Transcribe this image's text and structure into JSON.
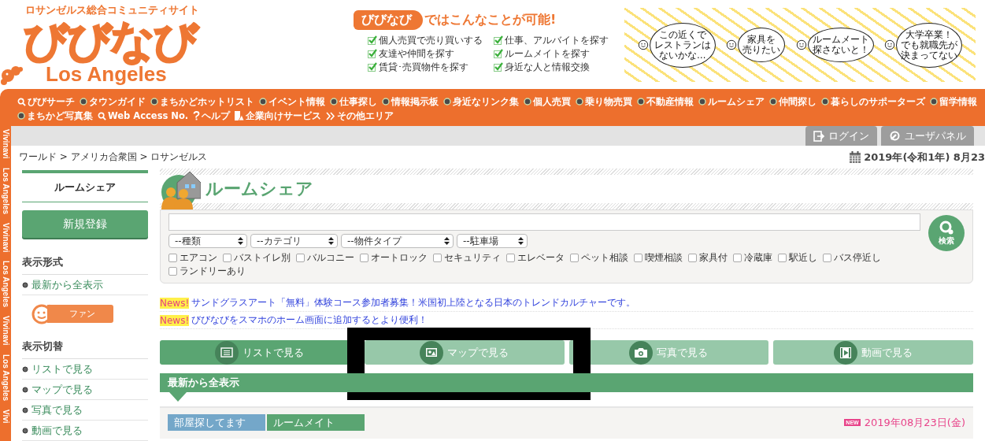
{
  "header": {
    "tagline": "ロサンゼルス総合コミュニティサイト",
    "logo": "びびなび",
    "logo_city": "Los Angeles"
  },
  "banner": {
    "brand": "びびなび",
    "headline": "ではこんなことが可能!",
    "features": [
      "個人売買で売り買いする",
      "仕事、アルバイトを探す",
      "友達や仲間を探す",
      "ルームメイトを探す",
      "賃貸･売買物件を探す",
      "身近な人と情報交換"
    ],
    "bubbles": [
      {
        "lines": [
          "この近くで",
          "レストランは",
          "ないかな…"
        ]
      },
      {
        "lines": [
          "家具を",
          "売りたい"
        ]
      },
      {
        "lines": [
          "ルームメート",
          "探さないと！"
        ]
      },
      {
        "lines": [
          "大学卒業！",
          "でも就職先が",
          "決まってない"
        ]
      }
    ]
  },
  "nav": {
    "rows": [
      [
        {
          "label": "びびサーチ",
          "kind": "search"
        },
        {
          "label": "タウンガイド",
          "kind": "dot"
        },
        {
          "label": "まちかどホットリスト",
          "kind": "dot"
        },
        {
          "label": "イベント情報",
          "kind": "dot"
        },
        {
          "label": "仕事探し",
          "kind": "dot"
        },
        {
          "label": "情報掲示板",
          "kind": "dot"
        },
        {
          "label": "身近なリンク集",
          "kind": "dot"
        },
        {
          "label": "個人売買",
          "kind": "dot"
        },
        {
          "label": "乗り物売買",
          "kind": "dot"
        },
        {
          "label": "不動産情報",
          "kind": "dot"
        },
        {
          "label": "ルームシェア",
          "kind": "dot"
        },
        {
          "label": "仲間探し",
          "kind": "dot"
        },
        {
          "label": "暮らしのサポーターズ",
          "kind": "dot"
        },
        {
          "label": "留学情報",
          "kind": "dot"
        }
      ],
      [
        {
          "label": "まちかど写真集",
          "kind": "dot"
        },
        {
          "label": "Web Access No.",
          "kind": "search"
        },
        {
          "label": "ヘルプ",
          "kind": "help"
        },
        {
          "label": "企業向けサービス",
          "kind": "building"
        },
        {
          "label": "その他エリア",
          "kind": "more"
        }
      ]
    ]
  },
  "side_strip": [
    "Vivinavi",
    "Los Angeles",
    "Vivinavi",
    "Los Angeles",
    "Vivinavi",
    "Los Angeles",
    "Vivi"
  ],
  "userbar": [
    {
      "label": "ログイン",
      "kind": "login"
    },
    {
      "label": "ユーザパネル",
      "kind": "panel"
    }
  ],
  "breadcrumb": "ワールド > アメリカ合衆国 > ロサンゼルス",
  "date": "2019年(令和1年) 8月23",
  "sidebar": {
    "title": "ルームシェア",
    "register_button": "新規登録",
    "sections": [
      {
        "heading": "表示形式",
        "links": [
          "最新から全表示"
        ],
        "badge": "ファン"
      },
      {
        "heading": "表示切替",
        "links": [
          "リストで見る",
          "マップで見る",
          "写真で見る",
          "動画で見る"
        ]
      }
    ]
  },
  "main": {
    "title": "ルームシェア",
    "search": {
      "selects": [
        "--種類",
        "--カテゴリ",
        "--物件タイプ",
        "--駐車場"
      ],
      "options": [
        {
          "label": "エアコン",
          "checked": false
        },
        {
          "label": "バストイレ別",
          "checked": false
        },
        {
          "label": "バルコニー",
          "checked": false
        },
        {
          "label": "オートロック",
          "checked": false
        },
        {
          "label": "セキュリティ",
          "checked": false
        },
        {
          "label": "エレベータ",
          "checked": false
        },
        {
          "label": "ペット相談",
          "checked": false
        },
        {
          "label": "喫煙相談",
          "checked": false
        },
        {
          "label": "家具付",
          "checked": false
        },
        {
          "label": "冷蔵庫",
          "checked": false
        },
        {
          "label": "駅近し",
          "checked": false
        },
        {
          "label": "バス停近し",
          "checked": false
        },
        {
          "label": "ランドリーあり",
          "checked": false
        }
      ],
      "button": "検索"
    },
    "news": [
      {
        "badge": "News!",
        "text": "サンドグラスアート「無料」体験コース参加者募集！米国初上陸となる日本のトレンドカルチャーです。"
      },
      {
        "badge": "News!",
        "text": "びびなびをスマホのホーム画面に追加するとより便利！"
      }
    ],
    "view_buttons": [
      {
        "label": "リストで見る",
        "kind": "list",
        "selected": true
      },
      {
        "label": "マップで見る",
        "kind": "map",
        "selected": false
      },
      {
        "label": "写真で見る",
        "kind": "photo",
        "selected": false
      },
      {
        "label": "動画で見る",
        "kind": "video",
        "selected": false
      }
    ],
    "section_title": "最新から全表示",
    "listing": {
      "tags": [
        {
          "label": "部屋探してます",
          "color": "#74a7c9"
        },
        {
          "label": "ルームメイト",
          "color": "#5aa572"
        }
      ],
      "new_badge": "NEW",
      "date": "2019年08月23日(金)"
    }
  }
}
